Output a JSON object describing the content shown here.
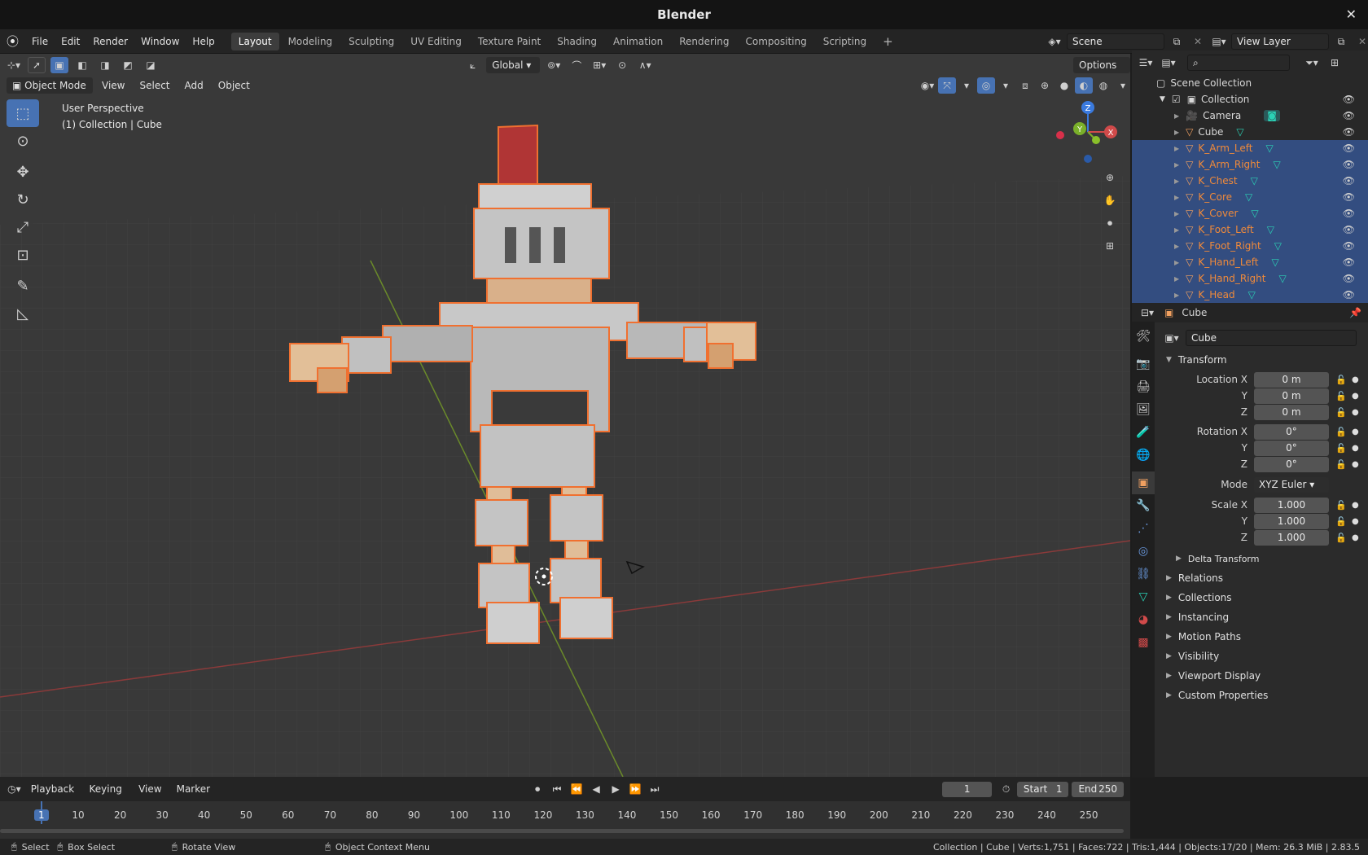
{
  "window": {
    "title": "Blender",
    "close": "✕"
  },
  "menu": {
    "items": [
      "File",
      "Edit",
      "Render",
      "Window",
      "Help"
    ]
  },
  "workspaces": {
    "tabs": [
      "Layout",
      "Modeling",
      "Sculpting",
      "UV Editing",
      "Texture Paint",
      "Shading",
      "Animation",
      "Rendering",
      "Compositing",
      "Scripting"
    ],
    "active": "Layout",
    "add": "+"
  },
  "scene": {
    "name": "Scene",
    "view_layer": "View Layer"
  },
  "viewport_header": {
    "mode": "Object Mode",
    "menus": [
      "View",
      "Select",
      "Add",
      "Object"
    ],
    "orientation": "Global",
    "options": "Options"
  },
  "viewport": {
    "perspective": "User Perspective",
    "context": "(1) Collection | Cube"
  },
  "gizmo": {
    "z": "Z",
    "y": "Y",
    "x": "X"
  },
  "outliner": {
    "search_placeholder": "",
    "root": "Scene Collection",
    "collection": "Collection",
    "items": [
      {
        "name": "Camera",
        "selected": false
      },
      {
        "name": "Cube",
        "selected": false
      },
      {
        "name": "K_Arm_Left",
        "selected": true
      },
      {
        "name": "K_Arm_Right",
        "selected": true
      },
      {
        "name": "K_Chest",
        "selected": true
      },
      {
        "name": "K_Core",
        "selected": true
      },
      {
        "name": "K_Cover",
        "selected": true
      },
      {
        "name": "K_Foot_Left",
        "selected": true
      },
      {
        "name": "K_Foot_Right",
        "selected": true
      },
      {
        "name": "K_Hand_Left",
        "selected": true
      },
      {
        "name": "K_Hand_Right",
        "selected": true
      },
      {
        "name": "K_Head",
        "selected": true
      }
    ]
  },
  "properties": {
    "header_name": "Cube",
    "object_name": "Cube",
    "transform_title": "Transform",
    "location": {
      "label": "Location X",
      "x": "0 m",
      "y": "0 m",
      "z": "0 m"
    },
    "rotation": {
      "label": "Rotation X",
      "x": "0°",
      "y": "0°",
      "z": "0°"
    },
    "mode_label": "Mode",
    "mode_value": "XYZ Euler",
    "scale": {
      "label": "Scale X",
      "x": "1.000",
      "y": "1.000",
      "z": "1.000"
    },
    "axis_y": "Y",
    "axis_z": "Z",
    "delta": "Delta Transform",
    "panels": [
      "Relations",
      "Collections",
      "Instancing",
      "Motion Paths",
      "Visibility",
      "Viewport Display",
      "Custom Properties"
    ]
  },
  "timeline": {
    "menus": [
      "Playback",
      "Keying",
      "View",
      "Marker"
    ],
    "current_frame": "1",
    "start_label": "Start",
    "start": "1",
    "end_label": "End",
    "end": "250",
    "ticks": [
      "1",
      "10",
      "20",
      "30",
      "40",
      "50",
      "60",
      "70",
      "80",
      "90",
      "100",
      "110",
      "120",
      "130",
      "140",
      "150",
      "160",
      "170",
      "180",
      "190",
      "200",
      "210",
      "220",
      "230",
      "240",
      "250"
    ]
  },
  "status": {
    "select": "Select",
    "box_select": "Box Select",
    "rotate": "Rotate View",
    "context_menu": "Object Context Menu",
    "stats": "Collection | Cube | Verts:1,751 | Faces:722 | Tris:1,444 | Objects:17/20 | Mem: 26.3 MiB | 2.83.5"
  },
  "colors": {
    "accent": "#4772b3",
    "selection": "#f08a3a",
    "selected_row": "#334d80",
    "mesh_icon": "#2bd1b5"
  }
}
